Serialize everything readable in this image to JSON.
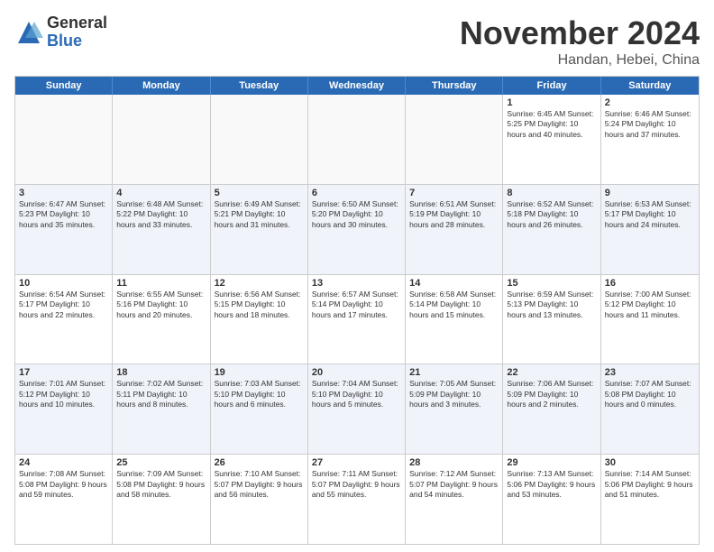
{
  "logo": {
    "general": "General",
    "blue": "Blue"
  },
  "title": "November 2024",
  "location": "Handan, Hebei, China",
  "days_of_week": [
    "Sunday",
    "Monday",
    "Tuesday",
    "Wednesday",
    "Thursday",
    "Friday",
    "Saturday"
  ],
  "weeks": [
    [
      {
        "day": "",
        "info": "",
        "empty": true
      },
      {
        "day": "",
        "info": "",
        "empty": true
      },
      {
        "day": "",
        "info": "",
        "empty": true
      },
      {
        "day": "",
        "info": "",
        "empty": true
      },
      {
        "day": "",
        "info": "",
        "empty": true
      },
      {
        "day": "1",
        "info": "Sunrise: 6:45 AM\nSunset: 5:25 PM\nDaylight: 10 hours\nand 40 minutes."
      },
      {
        "day": "2",
        "info": "Sunrise: 6:46 AM\nSunset: 5:24 PM\nDaylight: 10 hours\nand 37 minutes."
      }
    ],
    [
      {
        "day": "3",
        "info": "Sunrise: 6:47 AM\nSunset: 5:23 PM\nDaylight: 10 hours\nand 35 minutes."
      },
      {
        "day": "4",
        "info": "Sunrise: 6:48 AM\nSunset: 5:22 PM\nDaylight: 10 hours\nand 33 minutes."
      },
      {
        "day": "5",
        "info": "Sunrise: 6:49 AM\nSunset: 5:21 PM\nDaylight: 10 hours\nand 31 minutes."
      },
      {
        "day": "6",
        "info": "Sunrise: 6:50 AM\nSunset: 5:20 PM\nDaylight: 10 hours\nand 30 minutes."
      },
      {
        "day": "7",
        "info": "Sunrise: 6:51 AM\nSunset: 5:19 PM\nDaylight: 10 hours\nand 28 minutes."
      },
      {
        "day": "8",
        "info": "Sunrise: 6:52 AM\nSunset: 5:18 PM\nDaylight: 10 hours\nand 26 minutes."
      },
      {
        "day": "9",
        "info": "Sunrise: 6:53 AM\nSunset: 5:17 PM\nDaylight: 10 hours\nand 24 minutes."
      }
    ],
    [
      {
        "day": "10",
        "info": "Sunrise: 6:54 AM\nSunset: 5:17 PM\nDaylight: 10 hours\nand 22 minutes."
      },
      {
        "day": "11",
        "info": "Sunrise: 6:55 AM\nSunset: 5:16 PM\nDaylight: 10 hours\nand 20 minutes."
      },
      {
        "day": "12",
        "info": "Sunrise: 6:56 AM\nSunset: 5:15 PM\nDaylight: 10 hours\nand 18 minutes."
      },
      {
        "day": "13",
        "info": "Sunrise: 6:57 AM\nSunset: 5:14 PM\nDaylight: 10 hours\nand 17 minutes."
      },
      {
        "day": "14",
        "info": "Sunrise: 6:58 AM\nSunset: 5:14 PM\nDaylight: 10 hours\nand 15 minutes."
      },
      {
        "day": "15",
        "info": "Sunrise: 6:59 AM\nSunset: 5:13 PM\nDaylight: 10 hours\nand 13 minutes."
      },
      {
        "day": "16",
        "info": "Sunrise: 7:00 AM\nSunset: 5:12 PM\nDaylight: 10 hours\nand 11 minutes."
      }
    ],
    [
      {
        "day": "17",
        "info": "Sunrise: 7:01 AM\nSunset: 5:12 PM\nDaylight: 10 hours\nand 10 minutes."
      },
      {
        "day": "18",
        "info": "Sunrise: 7:02 AM\nSunset: 5:11 PM\nDaylight: 10 hours\nand 8 minutes."
      },
      {
        "day": "19",
        "info": "Sunrise: 7:03 AM\nSunset: 5:10 PM\nDaylight: 10 hours\nand 6 minutes."
      },
      {
        "day": "20",
        "info": "Sunrise: 7:04 AM\nSunset: 5:10 PM\nDaylight: 10 hours\nand 5 minutes."
      },
      {
        "day": "21",
        "info": "Sunrise: 7:05 AM\nSunset: 5:09 PM\nDaylight: 10 hours\nand 3 minutes."
      },
      {
        "day": "22",
        "info": "Sunrise: 7:06 AM\nSunset: 5:09 PM\nDaylight: 10 hours\nand 2 minutes."
      },
      {
        "day": "23",
        "info": "Sunrise: 7:07 AM\nSunset: 5:08 PM\nDaylight: 10 hours\nand 0 minutes."
      }
    ],
    [
      {
        "day": "24",
        "info": "Sunrise: 7:08 AM\nSunset: 5:08 PM\nDaylight: 9 hours\nand 59 minutes."
      },
      {
        "day": "25",
        "info": "Sunrise: 7:09 AM\nSunset: 5:08 PM\nDaylight: 9 hours\nand 58 minutes."
      },
      {
        "day": "26",
        "info": "Sunrise: 7:10 AM\nSunset: 5:07 PM\nDaylight: 9 hours\nand 56 minutes."
      },
      {
        "day": "27",
        "info": "Sunrise: 7:11 AM\nSunset: 5:07 PM\nDaylight: 9 hours\nand 55 minutes."
      },
      {
        "day": "28",
        "info": "Sunrise: 7:12 AM\nSunset: 5:07 PM\nDaylight: 9 hours\nand 54 minutes."
      },
      {
        "day": "29",
        "info": "Sunrise: 7:13 AM\nSunset: 5:06 PM\nDaylight: 9 hours\nand 53 minutes."
      },
      {
        "day": "30",
        "info": "Sunrise: 7:14 AM\nSunset: 5:06 PM\nDaylight: 9 hours\nand 51 minutes."
      }
    ]
  ]
}
